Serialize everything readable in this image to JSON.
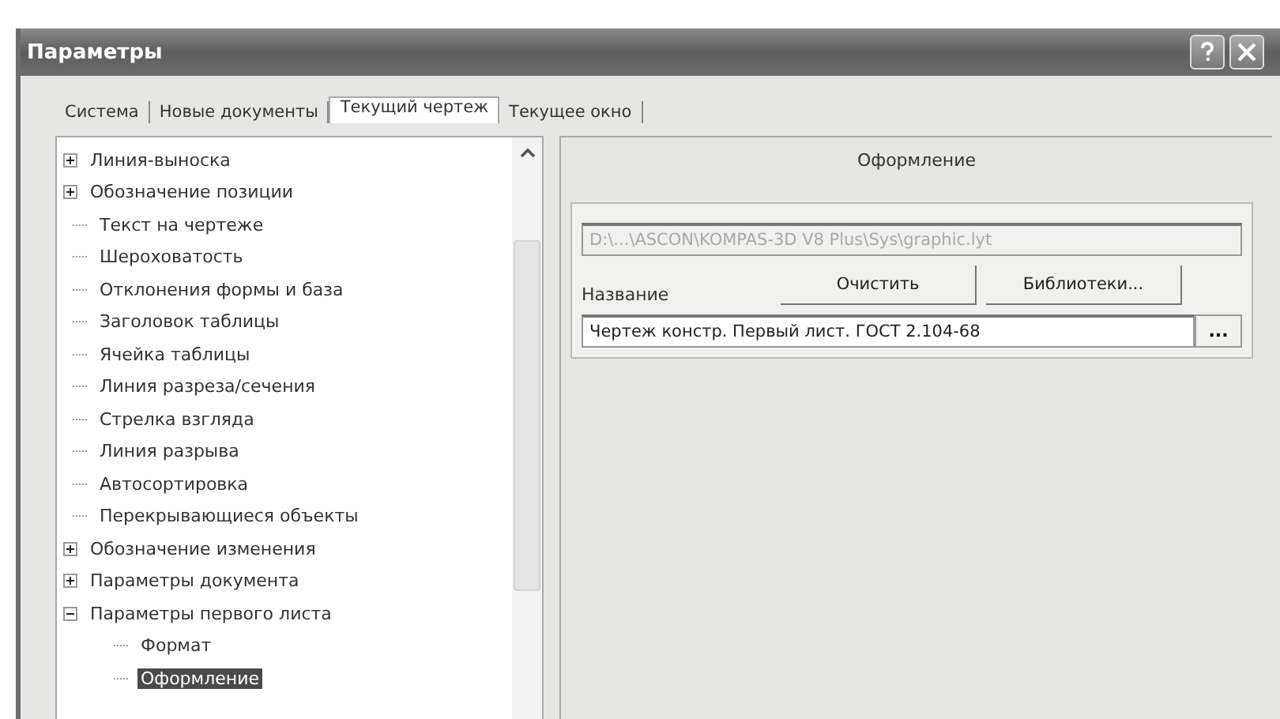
{
  "window": {
    "title": "Параметры"
  },
  "tabs": [
    {
      "label": "Система",
      "selected": false
    },
    {
      "label": "Новые документы",
      "selected": false
    },
    {
      "label": "Текущий чертеж",
      "selected": true
    },
    {
      "label": "Текущее окно",
      "selected": false
    }
  ],
  "tree": {
    "items": [
      {
        "label": "Линия-выноска",
        "expanded": false,
        "selected": false
      },
      {
        "label": "Обозначение позиции",
        "expanded": false,
        "selected": false
      },
      {
        "label": "Текст на чертеже",
        "selected": false
      },
      {
        "label": "Шероховатость",
        "selected": false
      },
      {
        "label": "Отклонения формы и база",
        "selected": false
      },
      {
        "label": "Заголовок таблицы",
        "selected": false
      },
      {
        "label": "Ячейка таблицы",
        "selected": false
      },
      {
        "label": "Линия разреза/сечения",
        "selected": false
      },
      {
        "label": "Стрелка взгляда",
        "selected": false
      },
      {
        "label": "Линия разрыва",
        "selected": false
      },
      {
        "label": "Автосортировка",
        "selected": false
      },
      {
        "label": "Перекрывающиеся объекты",
        "selected": false
      },
      {
        "label": "Обозначение изменения",
        "expanded": false,
        "selected": false
      },
      {
        "label": "Параметры документа",
        "expanded": false,
        "selected": false
      },
      {
        "label": "Параметры первого листа",
        "expanded": true,
        "selected": false,
        "children": [
          {
            "label": "Формат",
            "selected": false
          },
          {
            "label": "Оформление",
            "selected": true
          }
        ]
      }
    ]
  },
  "panel": {
    "heading": "Оформление",
    "path_field": {
      "value": "D:\\...\\ASCON\\KOMPAS-3D V8 Plus\\Sys\\graphic.lyt",
      "disabled": true
    },
    "name_label": "Название",
    "buttons": [
      "Очистить",
      "Библиотеки..."
    ],
    "name_field": {
      "value": "Чертеж констр. Первый лист. ГОСТ 2.104-68"
    },
    "browse_button": "..."
  }
}
